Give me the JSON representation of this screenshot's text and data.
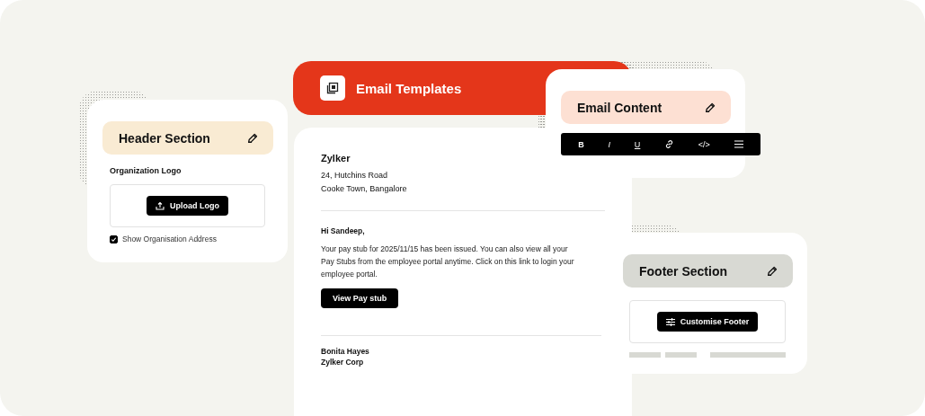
{
  "header_section": {
    "title": "Header Section",
    "field_label": "Organization Logo",
    "upload_button": "Upload Logo",
    "show_address": {
      "label": "Show Organisation Address",
      "checked": true
    }
  },
  "email_templates": {
    "title": "Email Templates"
  },
  "email": {
    "company": "Zylker",
    "address_lines": [
      "24, Hutchins Road",
      "Cooke Town, Bangalore"
    ],
    "greeting": "Hi Sandeep,",
    "body": "Your pay stub for 2025/11/15 has been issued. You can also view all your Pay Stubs from the employee portal anytime. Click on this link to login your employee portal.",
    "button": "View Pay stub",
    "signature": [
      "Bonita Hayes",
      "Zylker Corp"
    ]
  },
  "email_content": {
    "title": "Email Content",
    "toolbar": [
      {
        "kind": "bold",
        "label": "B"
      },
      {
        "kind": "italic",
        "label": "I"
      },
      {
        "kind": "underline",
        "label": "U"
      },
      {
        "kind": "link"
      },
      {
        "kind": "code",
        "label": "</>"
      },
      {
        "kind": "list"
      }
    ]
  },
  "footer_section": {
    "title": "Footer Section",
    "button": "Customise Footer"
  }
}
